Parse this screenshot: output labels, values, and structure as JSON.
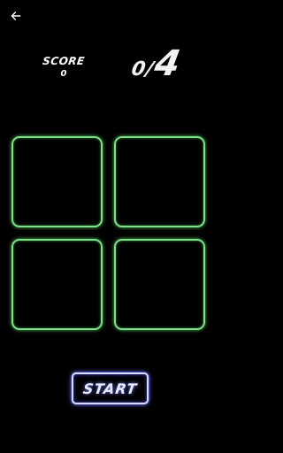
{
  "header": {
    "back_icon": "arrow-left-icon"
  },
  "score": {
    "label": "SCORE",
    "value": "0"
  },
  "progress": {
    "current": "0",
    "separator": "/",
    "total": "4"
  },
  "tiles": {
    "count": 4,
    "border_color": "#7fe08a"
  },
  "start_button": {
    "label": "START",
    "glow_color": "#5b66ff"
  }
}
